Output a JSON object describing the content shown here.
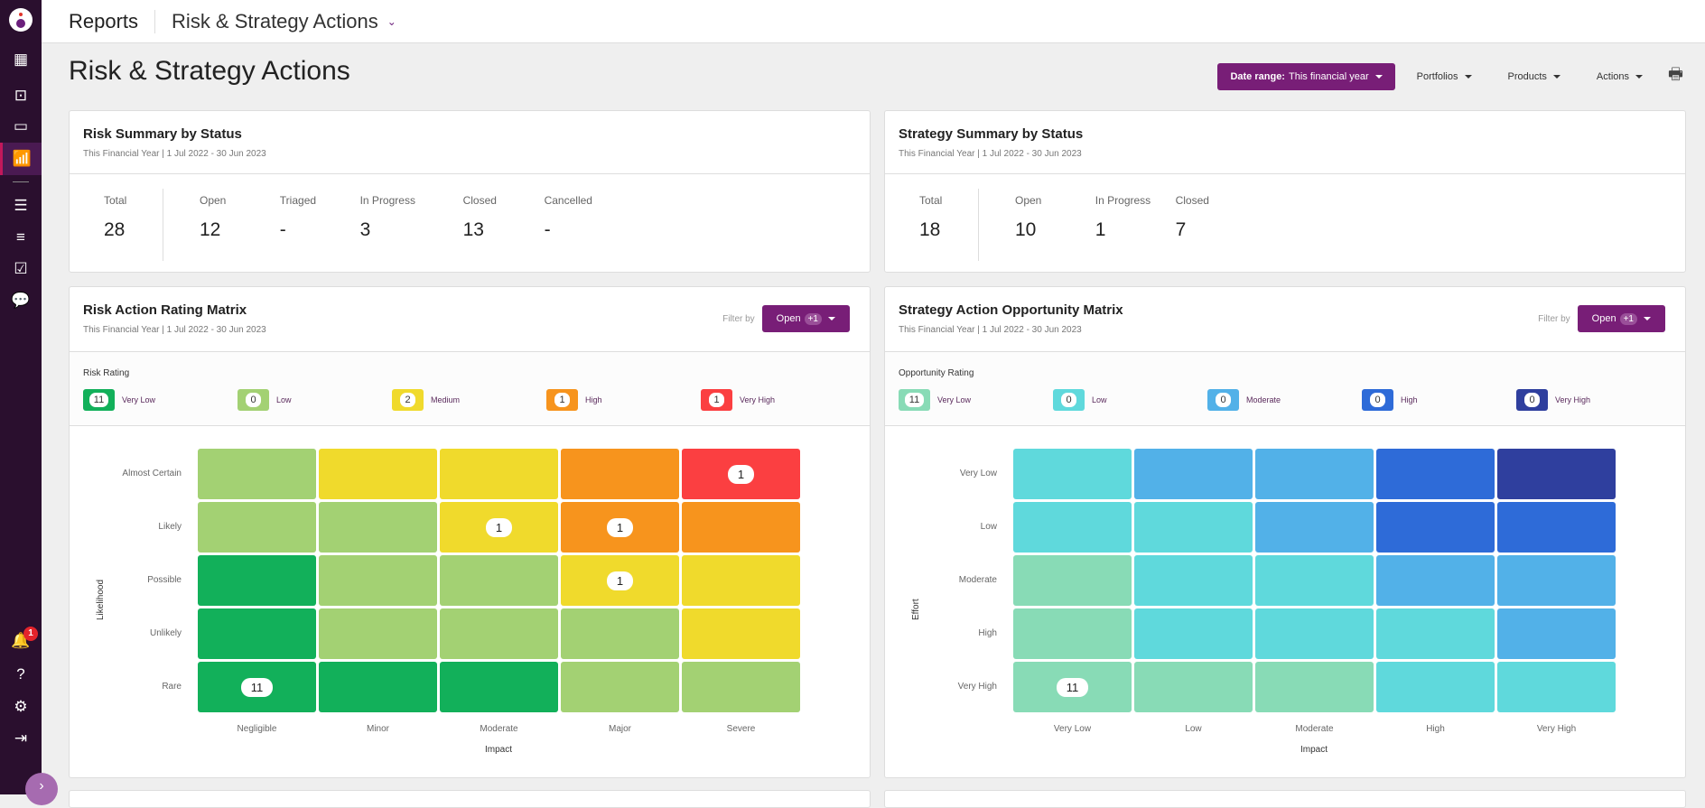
{
  "topbar": {
    "section": "Reports",
    "page": "Risk & Strategy Actions"
  },
  "sidebar": {
    "notification_count": "1"
  },
  "page": {
    "title": "Risk & Strategy Actions"
  },
  "toolbar": {
    "date_label": "Date range:",
    "date_value": "This financial year",
    "portfolios": "Portfolios",
    "products": "Products",
    "actions": "Actions"
  },
  "risk_summary": {
    "title": "Risk Summary by Status",
    "subtitle": "This Financial Year | 1 Jul 2022 - 30 Jun 2023",
    "total": {
      "label": "Total",
      "value": "28"
    },
    "stats": [
      {
        "label": "Open",
        "value": "12"
      },
      {
        "label": "Triaged",
        "value": "-"
      },
      {
        "label": "In Progress",
        "value": "3"
      },
      {
        "label": "Closed",
        "value": "13"
      },
      {
        "label": "Cancelled",
        "value": "-"
      }
    ]
  },
  "strategy_summary": {
    "title": "Strategy Summary by Status",
    "subtitle": "This Financial Year | 1 Jul 2022 - 30 Jun 2023",
    "total": {
      "label": "Total",
      "value": "18"
    },
    "stats": [
      {
        "label": "Open",
        "value": "10"
      },
      {
        "label": "In Progress",
        "value": "1"
      },
      {
        "label": "Closed",
        "value": "7"
      }
    ]
  },
  "risk_matrix": {
    "title": "Risk Action Rating Matrix",
    "subtitle": "This Financial Year | 1 Jul 2022 - 30 Jun 2023",
    "filter_label": "Filter by",
    "filter_value": "Open",
    "filter_extra": "+1",
    "legend_title": "Risk Rating",
    "levels": [
      {
        "name": "Very Low",
        "count": "11",
        "color": "#12b05a"
      },
      {
        "name": "Low",
        "count": "0",
        "color": "#a3d173"
      },
      {
        "name": "Medium",
        "count": "2",
        "color": "#f0da2c"
      },
      {
        "name": "High",
        "count": "1",
        "color": "#f7941d"
      },
      {
        "name": "Very High",
        "count": "1",
        "color": "#fb3f41"
      }
    ],
    "y_axis": "Likelihood",
    "x_axis": "Impact",
    "rows": [
      "Almost Certain",
      "Likely",
      "Possible",
      "Unlikely",
      "Rare"
    ],
    "cols": [
      "Negligible",
      "Minor",
      "Moderate",
      "Major",
      "Severe"
    ],
    "cells": [
      [
        1,
        2,
        2,
        3,
        4
      ],
      [
        1,
        1,
        2,
        3,
        3
      ],
      [
        0,
        1,
        1,
        2,
        2
      ],
      [
        0,
        1,
        1,
        1,
        2
      ],
      [
        0,
        0,
        0,
        1,
        1
      ]
    ],
    "counts": [
      [
        "",
        "",
        "",
        "",
        "1"
      ],
      [
        "",
        "",
        "1",
        "1",
        ""
      ],
      [
        "",
        "",
        "",
        "1",
        ""
      ],
      [
        "",
        "",
        "",
        "",
        ""
      ],
      [
        "11",
        "",
        "",
        "",
        ""
      ]
    ]
  },
  "opp_matrix": {
    "title": "Strategy Action Opportunity Matrix",
    "subtitle": "This Financial Year | 1 Jul 2022 - 30 Jun 2023",
    "filter_label": "Filter by",
    "filter_value": "Open",
    "filter_extra": "+1",
    "legend_title": "Opportunity Rating",
    "levels": [
      {
        "name": "Very Low",
        "count": "11",
        "color": "#88dbb6"
      },
      {
        "name": "Low",
        "count": "0",
        "color": "#5fd9dc"
      },
      {
        "name": "Moderate",
        "count": "0",
        "color": "#52b1e8"
      },
      {
        "name": "High",
        "count": "0",
        "color": "#2e6bd8"
      },
      {
        "name": "Very High",
        "count": "0",
        "color": "#2f3f9e"
      }
    ],
    "y_axis": "Effort",
    "x_axis": "Impact",
    "rows": [
      "Very Low",
      "Low",
      "Moderate",
      "High",
      "Very High"
    ],
    "cols": [
      "Very Low",
      "Low",
      "Moderate",
      "High",
      "Very High"
    ],
    "cells": [
      [
        1,
        2,
        2,
        3,
        4
      ],
      [
        1,
        1,
        2,
        3,
        3
      ],
      [
        0,
        1,
        1,
        2,
        2
      ],
      [
        0,
        1,
        1,
        1,
        2
      ],
      [
        0,
        0,
        0,
        1,
        1
      ]
    ],
    "counts": [
      [
        "",
        "",
        "",
        "",
        ""
      ],
      [
        "",
        "",
        "",
        "",
        ""
      ],
      [
        "",
        "",
        "",
        "",
        ""
      ],
      [
        "",
        "",
        "",
        "",
        ""
      ],
      [
        "11",
        "",
        "",
        "",
        ""
      ]
    ]
  }
}
